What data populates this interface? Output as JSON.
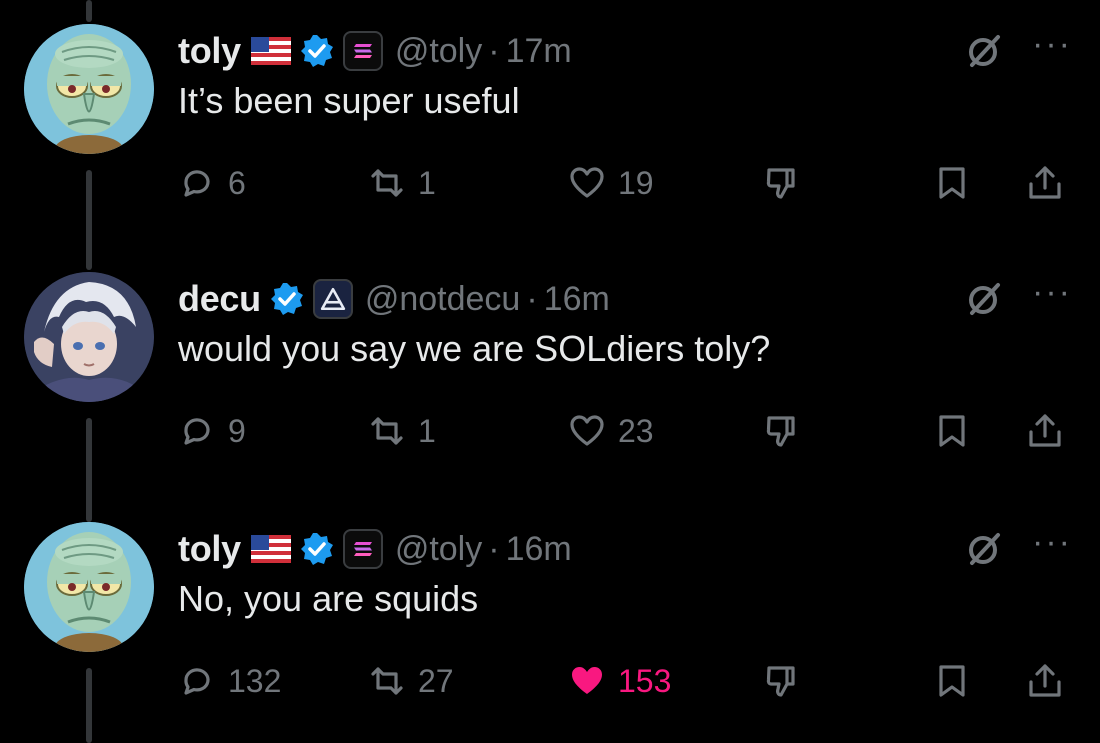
{
  "tweets": [
    {
      "name": "toly",
      "handle": "@toly",
      "separator": "·",
      "time": "17m",
      "text": "It’s been super useful",
      "replies": "6",
      "reposts": "1",
      "likes": "19",
      "liked": false,
      "flag_icon": "us-flag-icon",
      "affiliation_icon": "solana-logo-icon",
      "avatar": "squidward-avatar"
    },
    {
      "name": "decu",
      "handle": "@notdecu",
      "separator": "·",
      "time": "16m",
      "text": "would you say we are SOLdiers toly?",
      "replies": "9",
      "reposts": "1",
      "likes": "23",
      "liked": false,
      "affiliation_icon": "triangle-logo-icon",
      "avatar": "anime-boy-avatar"
    },
    {
      "name": "toly",
      "handle": "@toly",
      "separator": "·",
      "time": "16m",
      "text": "No, you are squids",
      "replies": "132",
      "reposts": "27",
      "likes": "153",
      "liked": true,
      "flag_icon": "us-flag-icon",
      "affiliation_icon": "solana-logo-icon",
      "avatar": "squidward-avatar"
    }
  ],
  "header_actions": {
    "more_label": "···"
  },
  "colors": {
    "background": "#000000",
    "text": "#e7e9ea",
    "muted": "#71767b",
    "like_active": "#f91880",
    "verified": "#1d9bf0"
  }
}
